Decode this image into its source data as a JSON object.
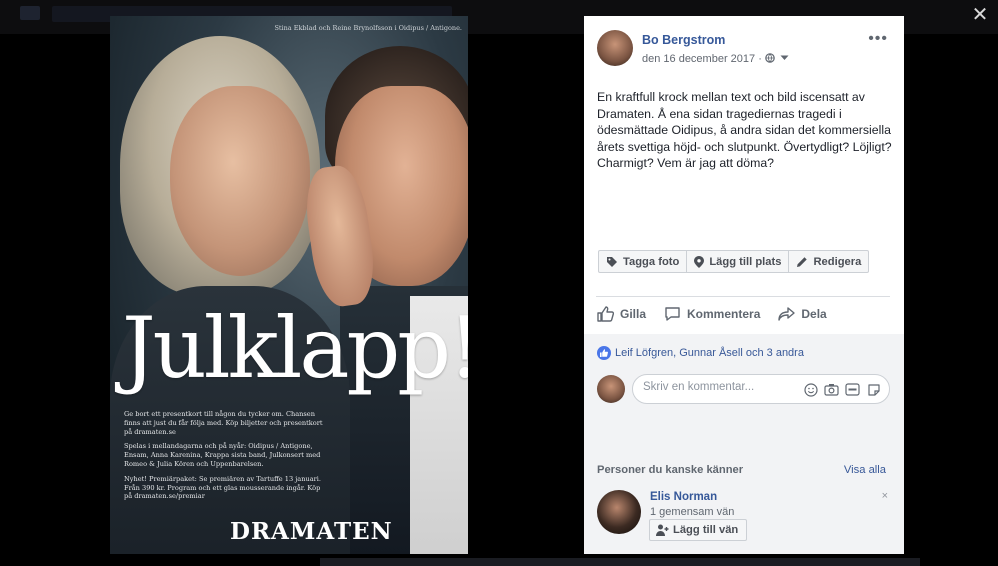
{
  "viewer": {
    "close_label": "✕"
  },
  "poster": {
    "credit": "Stina Ekblad och Reine Brynolfsson i Oidipus / Antigone.",
    "headline": "Julklapp!",
    "paragraphs": [
      "Ge bort ett presentkort till någon du tycker om. Chansen finns att just du får följa med. Köp biljetter och presentkort på dramaten.se",
      "Spelas i mellandagarna och på nyår: Oidipus / Antigone, Ensam, Anna Karenina, Krappa sista band, Julkonsert med Romeo & Julia Kören och Uppenbarelsen.",
      "Nyhet! Premiärpaket: Se premiären av Tartuffe 13 januari. Från 390 kr. Program och ett glas mousserande ingår. Köp på dramaten.se/premiar"
    ],
    "brand": "DRAMATEN"
  },
  "post": {
    "author": "Bo Bergstrom",
    "date": "den 16 december 2017 · ",
    "text": "En kraftfull krock mellan text och bild iscensatt av Dramaten. Å ena sidan tragediernas tragedi i ödesmättade Oidipus, å andra sidan det kommersiella årets svettiga höjd- och slutpunkt. Övertydligt? Löjligt? Charmigt? Vem är jag att döma?",
    "more_label": "•••"
  },
  "tag_buttons": {
    "tag_photo": "Tagga foto",
    "add_place": "Lägg till plats",
    "edit": "Redigera"
  },
  "actions": {
    "like": "Gilla",
    "comment": "Kommentera",
    "share": "Dela"
  },
  "reactions": {
    "text": "Leif Löfgren, Gunnar Åsell och 3 andra"
  },
  "comment": {
    "placeholder": "Skriv en kommentar..."
  },
  "suggestions": {
    "heading": "Personer du kanske känner",
    "see_all": "Visa alla",
    "person_name": "Elis Norman",
    "mutual": "1 gemensam vän",
    "add_friend": "Lägg till vän",
    "dismiss": "×"
  },
  "colors": {
    "link": "#365899",
    "like_blue": "#4a76e8",
    "backdrop": "#000000"
  }
}
